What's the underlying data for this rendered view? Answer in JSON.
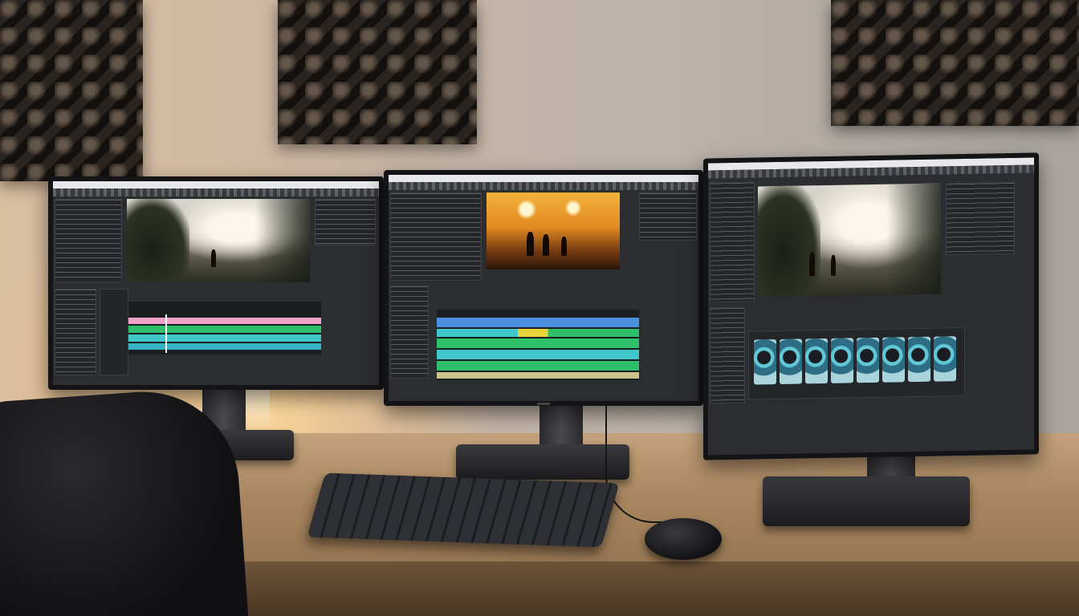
{
  "scene": {
    "monitors": [
      {
        "name": "left-monitor",
        "viewer": "forest-frame"
      },
      {
        "name": "center-monitor",
        "viewer": "sunset-frame"
      },
      {
        "name": "right-monitor",
        "viewer": "forest-frame"
      }
    ]
  },
  "colors": {
    "accent_pink": "#f0a2c8",
    "accent_green": "#2fbf6a",
    "accent_teal": "#3fc7c9",
    "accent_blue": "#4a8fe0",
    "accent_yellow": "#e6d23a"
  },
  "icons": [
    "keyboard-icon",
    "mouse-icon"
  ]
}
